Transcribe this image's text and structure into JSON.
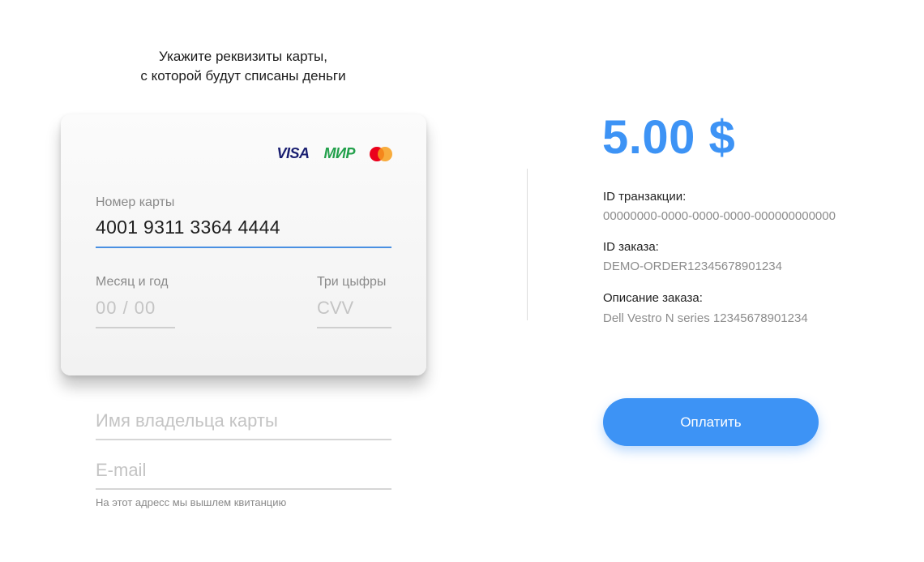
{
  "heading": {
    "line1": "Укажите реквизиты карты,",
    "line2": "с которой будут списаны деньги"
  },
  "card": {
    "logos": {
      "visa": "VISA",
      "mir": "МИР",
      "mastercard_icon": "mastercard-icon"
    },
    "number_label": "Номер карты",
    "number_value": "4001 9311 3364 4444",
    "month_label": "Месяц и год",
    "month_placeholder": "00  /  00",
    "cvv_label": "Три цыфры",
    "cvv_placeholder": "CVV"
  },
  "form": {
    "holder_placeholder": "Имя владельца карты",
    "email_placeholder": "E-mail",
    "email_hint": "На этот адресс мы вышлем квитанцию"
  },
  "summary": {
    "amount": "5.00 $",
    "transaction_label": "ID транзакции:",
    "transaction_value": "00000000-0000-0000-0000-000000000000",
    "order_label": "ID заказа:",
    "order_value": "DEMO-ORDER12345678901234",
    "description_label": "Описание заказа:",
    "description_value": "Dell Vestro N series 12345678901234"
  },
  "actions": {
    "pay_label": "Оплатить"
  },
  "colors": {
    "accent": "#3d93f5",
    "visa": "#1a1f71",
    "mir": "#22a04b",
    "mastercard_red": "#eb001b",
    "mastercard_orange": "#f79e1b"
  }
}
